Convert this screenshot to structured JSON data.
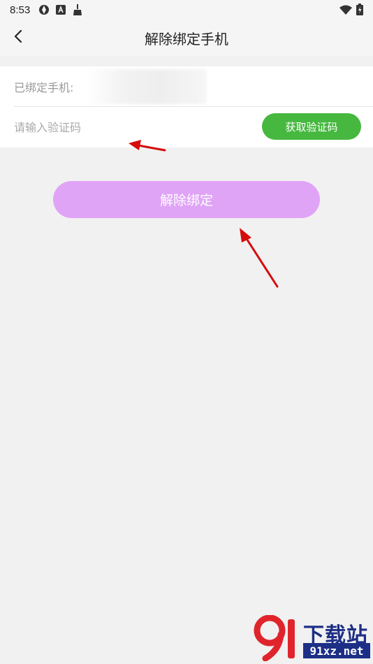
{
  "status_bar": {
    "time": "8:53",
    "icons_left": [
      "aperture-icon",
      "a-square-icon",
      "broom-icon"
    ],
    "icons_right": [
      "wifi-icon",
      "battery-charging-icon"
    ]
  },
  "nav": {
    "back_icon": "chevron-left-icon",
    "title": "解除绑定手机"
  },
  "form": {
    "bound_phone_label": "已绑定手机:",
    "code_placeholder": "请输入验证码",
    "code_value": "",
    "get_code_label": "获取验证码"
  },
  "unbind_button": {
    "label": "解除绑定"
  },
  "watermark": {
    "title": "下载站",
    "site": "91xz.net"
  },
  "colors": {
    "page_bg": "#f1f1f1",
    "card_bg": "#ffffff",
    "get_code_green": "#46b83f",
    "unbind_purple": "#e0a4f7",
    "annotation_arrow": "#d60b0b",
    "watermark_navy": "#1d2e86",
    "watermark_red": "#e0242b"
  }
}
